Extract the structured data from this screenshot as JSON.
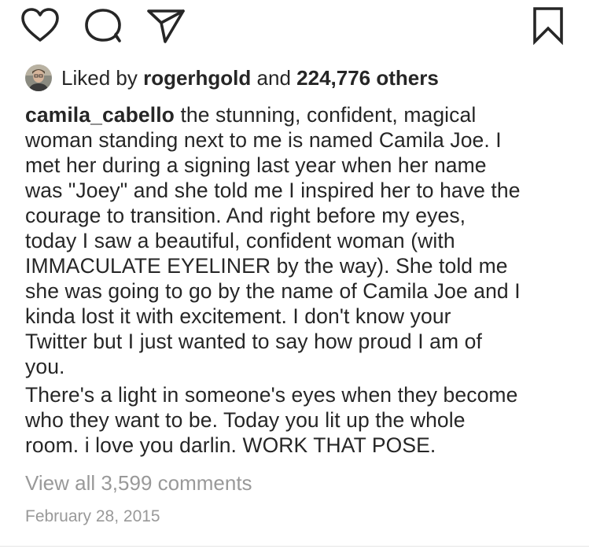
{
  "actions": {
    "like_icon": "heart-outline-icon",
    "comment_icon": "comment-bubble-icon",
    "share_icon": "paper-plane-icon",
    "save_icon": "bookmark-outline-icon"
  },
  "likes": {
    "prefix": "Liked by",
    "user": "rogerhgold",
    "conjunction": "and",
    "count_text": "224,776 others"
  },
  "caption": {
    "username": "camila_cabello",
    "lines": [
      "the stunning, confident, magical",
      "woman standing next to me is named Camila Joe. I",
      "met her during a signing last year when her name",
      "was \"Joey\" and she told me I inspired her to have the",
      "courage to transition. And right before my eyes,",
      "today I saw a beautiful, confident woman (with",
      "IMMACULATE EYELINER by the way). She told me",
      "she was going to go by the name of Camila Joe and I",
      "kinda lost it with excitement. I don't know your",
      "Twitter but I just wanted to say how proud I am of",
      "you.",
      "There's a light in someone's eyes when they become",
      "who they want to be. Today you lit up the whole",
      "room. i love you darlin. WORK THAT POSE."
    ]
  },
  "comments": {
    "view_all": "View all 3,599 comments"
  },
  "timestamp": "February 28, 2015",
  "colors": {
    "text": "#262626",
    "muted": "#999999",
    "divider": "#e6e6e6"
  }
}
